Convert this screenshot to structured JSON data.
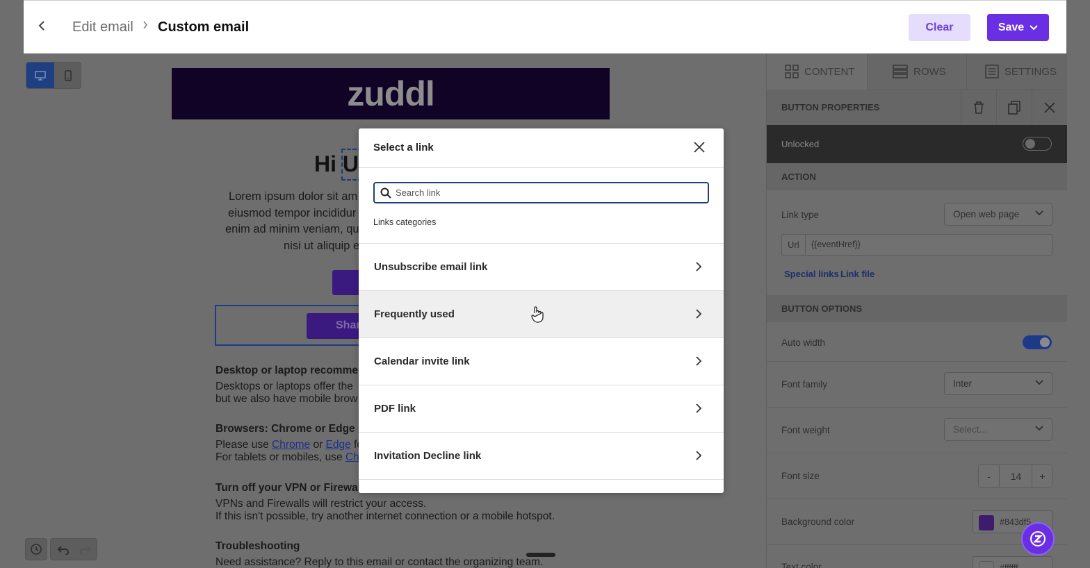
{
  "header": {
    "breadcrumb_parent": "Edit email",
    "breadcrumb_current": "Custom email",
    "clear_label": "Clear",
    "save_label": "Save"
  },
  "email": {
    "logo_text": "zuddl",
    "greeting_visible": "Hi U",
    "lorem_lines": [
      "Lorem ipsum dolor sit am",
      "eiusmod tempor incididur",
      "enim ad minim veniam, qu",
      "nisi ut aliquip e"
    ],
    "share_partial": "Shar",
    "sections": {
      "desktop_title": "Desktop or laptop recommen",
      "desktop_line1": "Desktops or laptops offer the",
      "desktop_line2": "but we also have mobile brow",
      "browsers_title": "Browsers: Chrome or Edge",
      "browsers_line1_pre": "Please use ",
      "browsers_link1": "Chrome",
      "browsers_line1_mid": " or ",
      "browsers_link2": "Edge",
      "browsers_line1_post": " fo",
      "browsers_line2_pre": "For tablets or mobiles, use ",
      "browsers_link3": "Ch",
      "vpn_title": "Turn off your VPN or Firewall",
      "vpn_line1": "VPNs and Firewalls will restrict your access.",
      "vpn_line2": "If this isn't possible, try another internet connection or a mobile hotspot.",
      "trouble_title": "Troubleshooting",
      "trouble_line1": "Need assistance? Reply to this email or contact the organizing team."
    }
  },
  "right_panel": {
    "tabs": [
      "CONTENT",
      "ROWS",
      "SETTINGS"
    ],
    "props_title": "BUTTON PROPERTIES",
    "unlocked_label": "Unlocked",
    "action_header": "ACTION",
    "link_type_label": "Link type",
    "link_type_value": "Open web page",
    "url_tag": "Url",
    "url_value": "{{eventHref}}",
    "special_links": "Special links",
    "link_file": "Link file",
    "options_header": "BUTTON OPTIONS",
    "auto_width_label": "Auto width",
    "font_family_label": "Font family",
    "font_family_value": "Inter",
    "font_weight_label": "Font weight",
    "font_weight_value": "Select...",
    "font_size_label": "Font size",
    "font_size_minus": "-",
    "font_size_value": "14",
    "font_size_plus": "+",
    "bg_color_label": "Background color",
    "bg_color_value": "#843df5",
    "text_color_label": "Text color",
    "text_color_value": "#ffffff"
  },
  "modal": {
    "title": "Select a link",
    "search_placeholder": "Search link",
    "categories_label": "Links categories",
    "items": [
      {
        "label": "Unsubscribe email link"
      },
      {
        "label": "Frequently used"
      },
      {
        "label": "Calendar invite link"
      },
      {
        "label": "PDF link"
      },
      {
        "label": "Invitation Decline link"
      }
    ]
  },
  "colors": {
    "accent": "#6b2fe3",
    "accent_light": "#e6dcfb",
    "focus_blue": "#1f3f83",
    "swatch": "#843df5"
  }
}
